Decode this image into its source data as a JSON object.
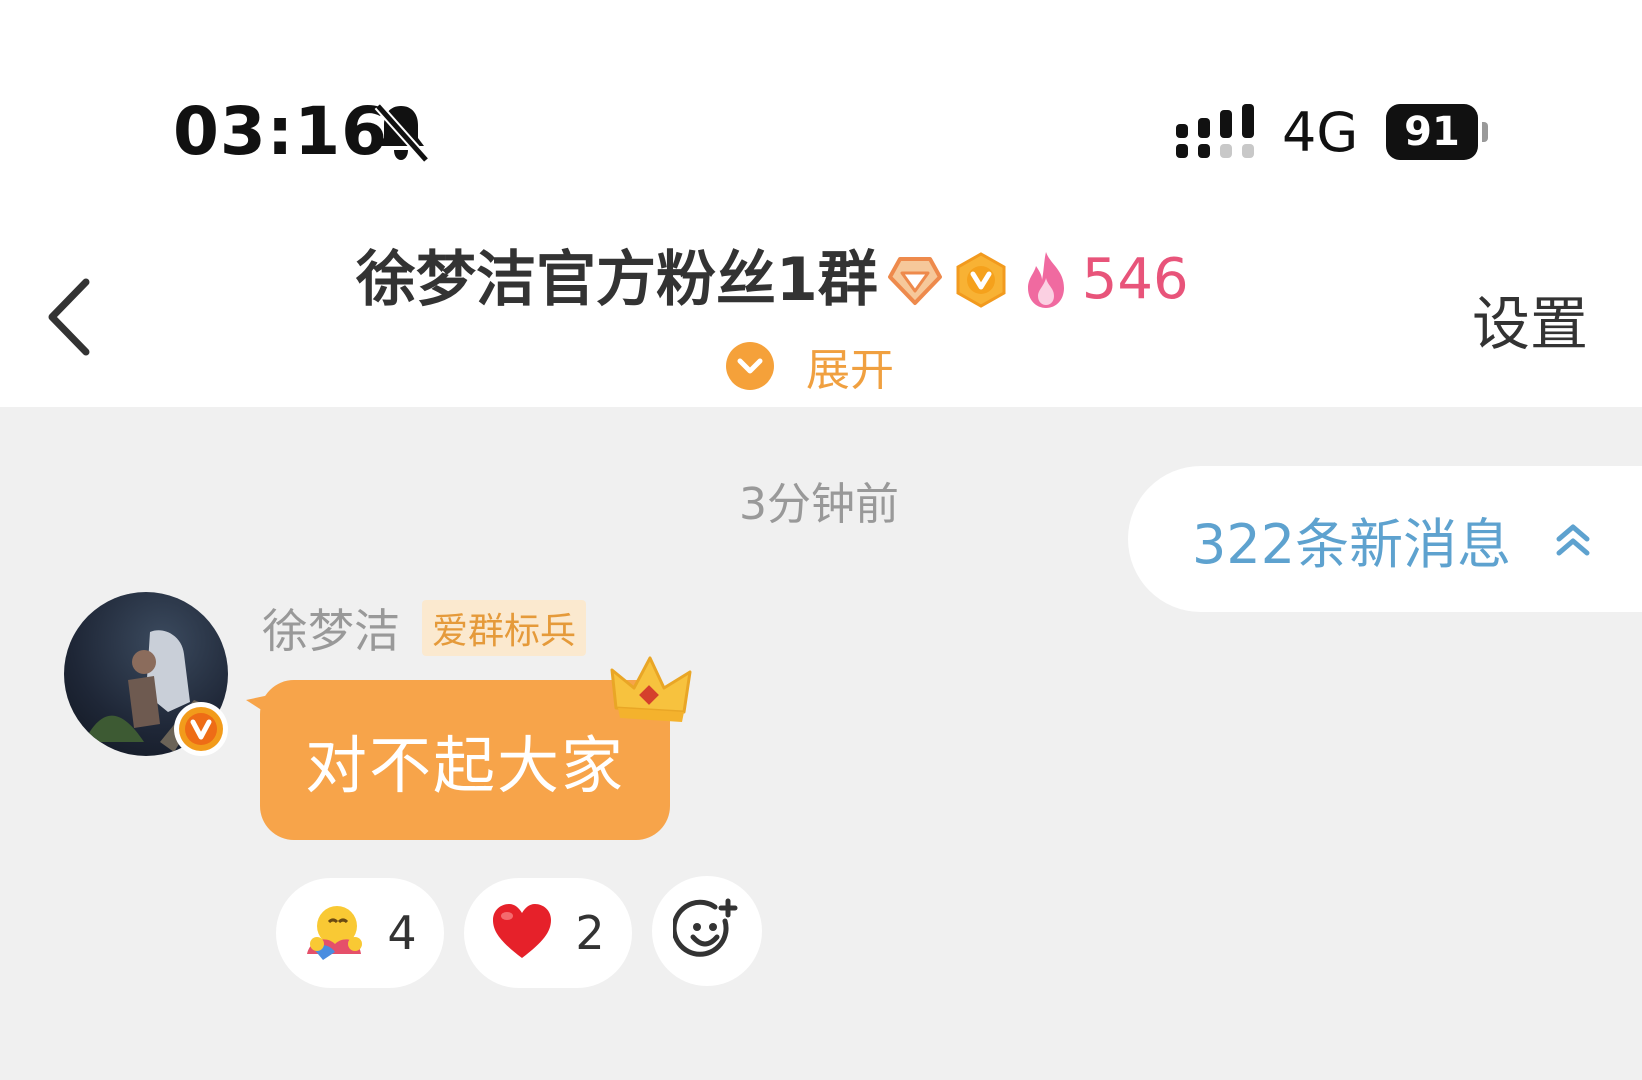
{
  "status_bar": {
    "time": "03:16",
    "network": "4G",
    "battery": "91"
  },
  "header": {
    "title": "徐梦洁官方粉丝1群",
    "fire_count": "546",
    "expand_label": "展开",
    "settings_label": "设置"
  },
  "chat": {
    "timestamp": "3分钟前",
    "new_messages_label": "322条新消息",
    "message": {
      "sender": "徐梦洁",
      "sender_tag": "爱群标兵",
      "text": "对不起大家"
    },
    "reactions": [
      {
        "icon": "hug-emoji-icon",
        "count": "4"
      },
      {
        "icon": "heart-icon",
        "count": "2"
      }
    ]
  },
  "colors": {
    "accent_orange": "#f7a44a",
    "link_blue": "#5ea2cf",
    "fire_pink": "#e8547a"
  }
}
